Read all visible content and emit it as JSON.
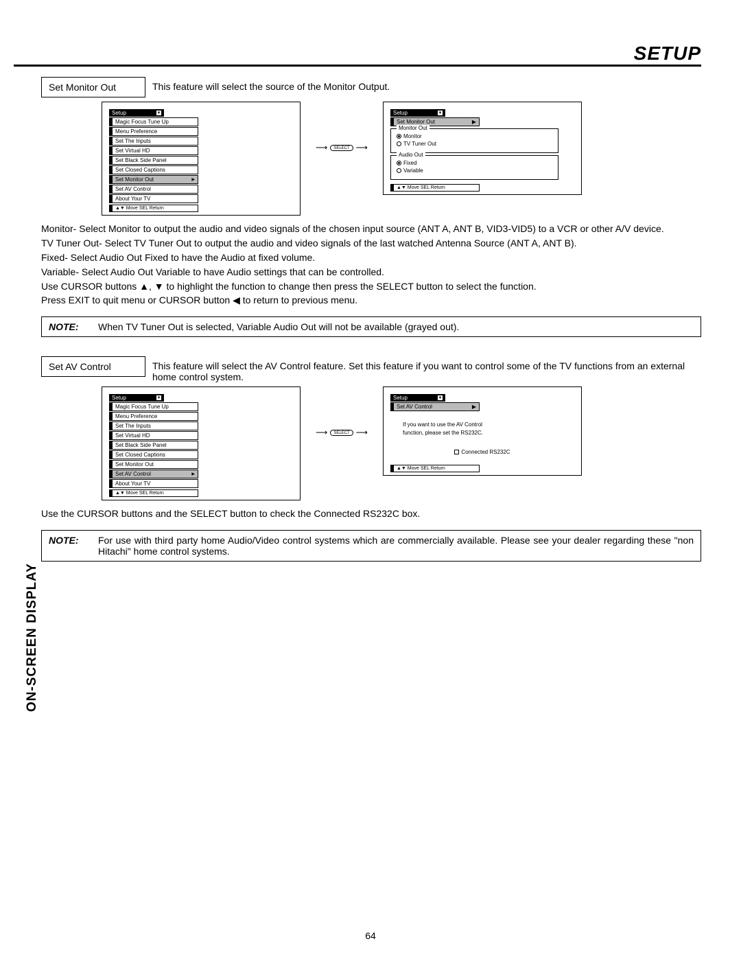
{
  "page": {
    "title": "SETUP",
    "sideTab": "ON-SCREEN DISPLAY",
    "number": "64"
  },
  "section1": {
    "label": "Set Monitor Out",
    "desc": "This feature will select the source of the Monitor Output.",
    "menuLeft": {
      "title": "Setup",
      "items": [
        "Magic Focus Tune Up",
        "Menu Preference",
        "Set The Inputs",
        "Set Virtual HD",
        "Set Black Side Panel",
        "Set Closed Captions",
        "Set Monitor Out",
        "Set AV Control",
        "About Your TV"
      ],
      "highlightIndex": 6,
      "footer": "▲▼ Move  SEL  Return"
    },
    "connector": "SELECT",
    "menuRight": {
      "title": "Setup",
      "subtitle": "Set Monitor Out",
      "group1": {
        "label": "Monitor Out",
        "opts": [
          "Monitor",
          "TV Tuner Out"
        ],
        "selected": 0
      },
      "group2": {
        "label": "Audio Out",
        "opts": [
          "Fixed",
          "Variable"
        ],
        "selected": 0
      },
      "footer": "▲▼ Move  SEL  Return"
    },
    "body": [
      "Monitor- Select Monitor to output the audio and video signals of the chosen input source (ANT A, ANT B, VID3-VID5) to a VCR or other A/V device.",
      "TV Tuner Out- Select TV Tuner Out to output the audio and video signals of the last watched Antenna Source (ANT A, ANT B).",
      "Fixed-  Select Audio Out Fixed to have the Audio at fixed volume.",
      "Variable- Select Audio Out Variable to have Audio settings that can be controlled.",
      "Use CURSOR buttons ▲, ▼ to highlight the function to change then press the SELECT button to select the function.",
      "Press EXIT to quit menu or CURSOR button ◀ to return to previous menu."
    ],
    "note": {
      "label": "NOTE:",
      "text": "When TV Tuner Out is selected, Variable Audio Out will not be available (grayed out)."
    }
  },
  "section2": {
    "label": "Set AV Control",
    "desc": "This feature will select the AV Control feature.  Set this feature if you want to control some of the TV functions from an external home control system.",
    "menuLeft": {
      "title": "Setup",
      "items": [
        "Magic Focus Tune Up",
        "Menu Preference",
        "Set The Inputs",
        "Set Virtual HD",
        "Set Black Side Panel",
        "Set Closed Captions",
        "Set Monitor Out",
        "Set AV Control",
        "About Your TV"
      ],
      "highlightIndex": 7,
      "footer": "▲▼ Move  SEL  Return"
    },
    "connector": "SELECT",
    "menuRight": {
      "title": "Setup",
      "subtitle": "Set AV Control",
      "info": [
        "If you want to use the AV Control",
        "function, please set the RS232C."
      ],
      "checkbox": "Connected RS232C",
      "footer": "▲▼ Move  SEL  Return"
    },
    "body": [
      "Use the CURSOR buttons and the SELECT button to check the Connected RS232C box."
    ],
    "note": {
      "label": "NOTE:",
      "text": "For use with third party home Audio/Video control systems which are commercially available.  Please see your dealer regarding these \"non Hitachi\" home control systems."
    }
  }
}
